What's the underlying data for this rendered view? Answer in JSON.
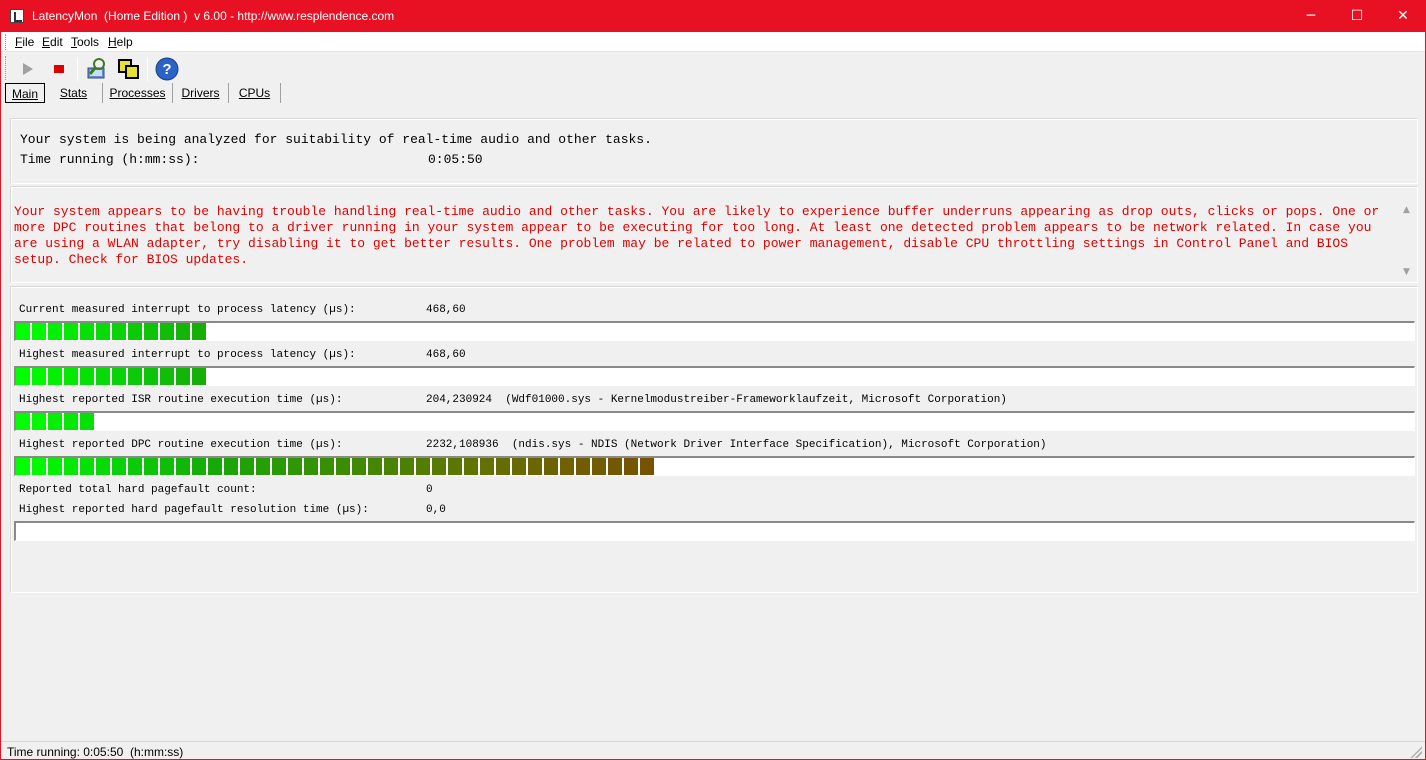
{
  "window": {
    "title": "LatencyMon  (Home Edition )  v 6.00 - http://www.resplendence.com",
    "minimize_glyph": "─",
    "maximize_glyph": "☐",
    "close_glyph": "✕"
  },
  "menu": {
    "file_u": "F",
    "file_rest": "ile",
    "edit_u": "E",
    "edit_rest": "dit",
    "tools_u": "T",
    "tools_rest": "ools",
    "help_u": "H",
    "help_rest": "elp"
  },
  "toolbar": {
    "icons": [
      "play-icon",
      "stop-icon",
      "find-driver-icon",
      "copy-icon",
      "help-icon"
    ]
  },
  "tabs": {
    "main": "Main",
    "stats": "Stats",
    "processes": "Processes",
    "drivers": "Drivers",
    "cpus": "CPUs"
  },
  "analysis": {
    "line1": "Your system is being analyzed for suitability of real-time audio and other tasks.",
    "time_label": "Time running (h:mm:ss):",
    "time_value": "0:05:50"
  },
  "verdict": {
    "text": "Your system appears to be having trouble handling real-time audio and other tasks. You are likely to experience buffer underruns appearing as drop outs, clicks or pops. One or more DPC routines that belong to a driver running in your system appear to be executing for too long. At least one detected problem appears to be network related. In case you are using a WLAN adapter, try disabling it to get better results. One problem may be related to power management, disable CPU throttling settings in Control Panel and BIOS setup. Check for BIOS updates.",
    "color": "#e00000"
  },
  "metrics": {
    "current_latency": {
      "label": "Current measured interrupt to process latency (µs):",
      "value": "468,60",
      "bar_segments": 12
    },
    "highest_latency": {
      "label": "Highest measured interrupt to process latency (µs):",
      "value": "468,60",
      "bar_segments": 12
    },
    "highest_isr": {
      "label": "Highest reported ISR routine execution time (µs):",
      "value": "204,230924  (Wdf01000.sys - Kernelmodustreiber-Frameworklaufzeit, Microsoft Corporation)",
      "bar_segments": 5
    },
    "highest_dpc": {
      "label": "Highest reported DPC routine execution time (µs):",
      "value": "2232,108936  (ndis.sys - NDIS (Network Driver Interface Specification), Microsoft Corporation)",
      "bar_segments": 40
    },
    "pagefault_count": {
      "label": "Reported total hard pagefault count:",
      "value": "0"
    },
    "pagefault_time": {
      "label": "Highest reported hard pagefault resolution time (µs):",
      "value": "0,0",
      "bar_segments": 0
    }
  },
  "status": {
    "text": "Time running: 0:05:50  (h:mm:ss)"
  }
}
